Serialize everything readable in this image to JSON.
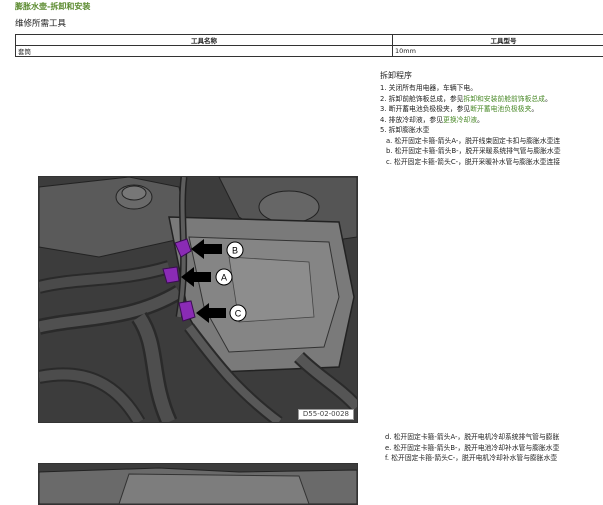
{
  "page": {
    "title": "膨胀水壶-拆卸和安装",
    "subtitle": "维修所需工具"
  },
  "tools_table": {
    "headers": [
      "工具名称",
      "工具型号"
    ],
    "rows": [
      {
        "name": "套筒",
        "model": "10mm"
      }
    ]
  },
  "procedure": {
    "heading": "拆卸程序",
    "steps": [
      {
        "prefix": "1. 关闭所有用电器，车辆下电。",
        "link": "",
        "suffix": ""
      },
      {
        "prefix": "2. 拆卸前舱饰板总成，参见",
        "link": "拆卸和安装前舱前饰板总成",
        "suffix": "。"
      },
      {
        "prefix": "3. 断开蓄电池负极极夹，参见",
        "link": "断开蓄电池负极极夹",
        "suffix": "。"
      },
      {
        "prefix": "4. 排放冷却液，参见",
        "link": "更换冷却液",
        "suffix": "。"
      },
      {
        "prefix": "5. 拆卸膨胀水壶",
        "link": "",
        "suffix": ""
      }
    ],
    "substeps_upper": [
      "a. 松开固定卡箍-箭头A-，脱开线束固定卡扣与膨胀水壶连",
      "b. 松开固定卡箍-箭头B-，脱开采暖系统排气管与膨胀水壶",
      "c. 松开固定卡箍-箭头C-，脱开采暖补水管与膨胀水壶连接"
    ],
    "substeps_lower": [
      "d. 松开固定卡箍-箭头A-，脱开电机冷却系统排气管与膨胀",
      "e. 松开固定卡箍-箭头B-，脱开电池冷却补水管与膨胀水壶",
      "f. 松开固定卡箍-箭头C-，脱开电机冷却补水管与膨胀水壶"
    ]
  },
  "figure": {
    "code": "D55-02-0028",
    "callouts": [
      "B",
      "A",
      "C"
    ],
    "clamp_color": "#8a2bb5"
  }
}
